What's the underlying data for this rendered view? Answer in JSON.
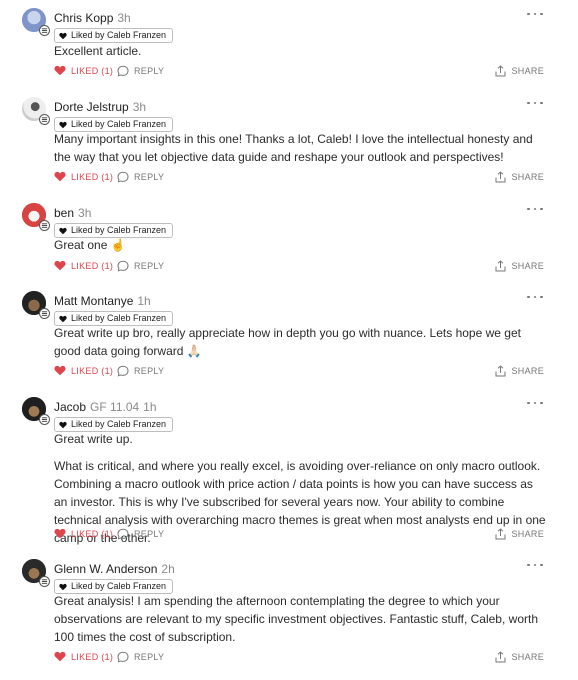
{
  "liked_by": "Liked by Caleb Franzen",
  "liked_label": "LIKED (1)",
  "reply_label": "REPLY",
  "share_label": "SHARE",
  "colors": {
    "liked": "#e0454d",
    "muted": "#8a8a8a"
  },
  "comments": [
    {
      "name": "Chris Kopp",
      "time": "3h",
      "meta": "",
      "body": [
        "Excellent article."
      ]
    },
    {
      "name": "Dorte Jelstrup",
      "time": "3h",
      "meta": "",
      "body": [
        "Many important insights in this one! Thanks a lot, Caleb! I love the intellectual honesty and the way that you let objective data guide and reshape your outlook and perspectives!"
      ]
    },
    {
      "name": "ben",
      "time": "3h",
      "meta": "",
      "body": [
        "Great one ☝️"
      ]
    },
    {
      "name": "Matt Montanye",
      "time": "1h",
      "meta": "",
      "body": [
        "Great write up bro, really appreciate how in depth you go with nuance. Lets hope we get good data going forward 🙏🏻"
      ]
    },
    {
      "name": "Jacob",
      "time": "1h",
      "meta": "GF 11.04",
      "body": [
        "Great write up.",
        "What is critical, and where you really excel, is avoiding over-reliance on only macro outlook. Combining a macro outlook with price action / data points is how you can have success as an investor. This is why I've subscribed for several years now. Your ability to combine technical analysis with overarching macro themes is great when most analysts end up in one camp or the other."
      ]
    },
    {
      "name": "Glenn W. Anderson",
      "time": "2h",
      "meta": "",
      "body": [
        "Great analysis! I am spending the afternoon contemplating the degree to which your observations are relevant to my specific investment objectives. Fantastic stuff, Caleb, worth 100 times the cost of subscription."
      ]
    }
  ]
}
